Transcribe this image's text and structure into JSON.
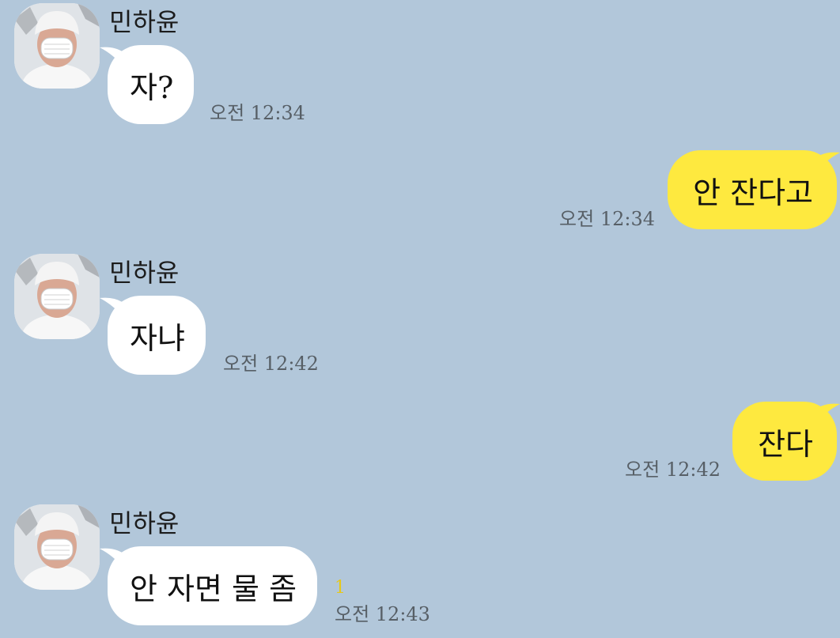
{
  "messages": [
    {
      "direction": "in",
      "sender": "민하윤",
      "text": "자?",
      "time": "오전 12:34",
      "avatar": "profile-avatar"
    },
    {
      "direction": "out",
      "text": "안 잔다고",
      "time": "오전 12:34"
    },
    {
      "direction": "in",
      "sender": "민하윤",
      "text": "자냐",
      "time": "오전 12:42",
      "avatar": "profile-avatar"
    },
    {
      "direction": "out",
      "text": "잔다",
      "time": "오전 12:42"
    },
    {
      "direction": "in",
      "sender": "민하윤",
      "text": "안 자면 물 좀",
      "time": "오전 12:43",
      "unread": "1",
      "avatar": "profile-avatar"
    }
  ],
  "colors": {
    "background": "#b2c7da",
    "incoming_bubble": "#ffffff",
    "outgoing_bubble": "#fee93f",
    "timestamp": "#575f66",
    "unread_count": "#e6c819"
  }
}
